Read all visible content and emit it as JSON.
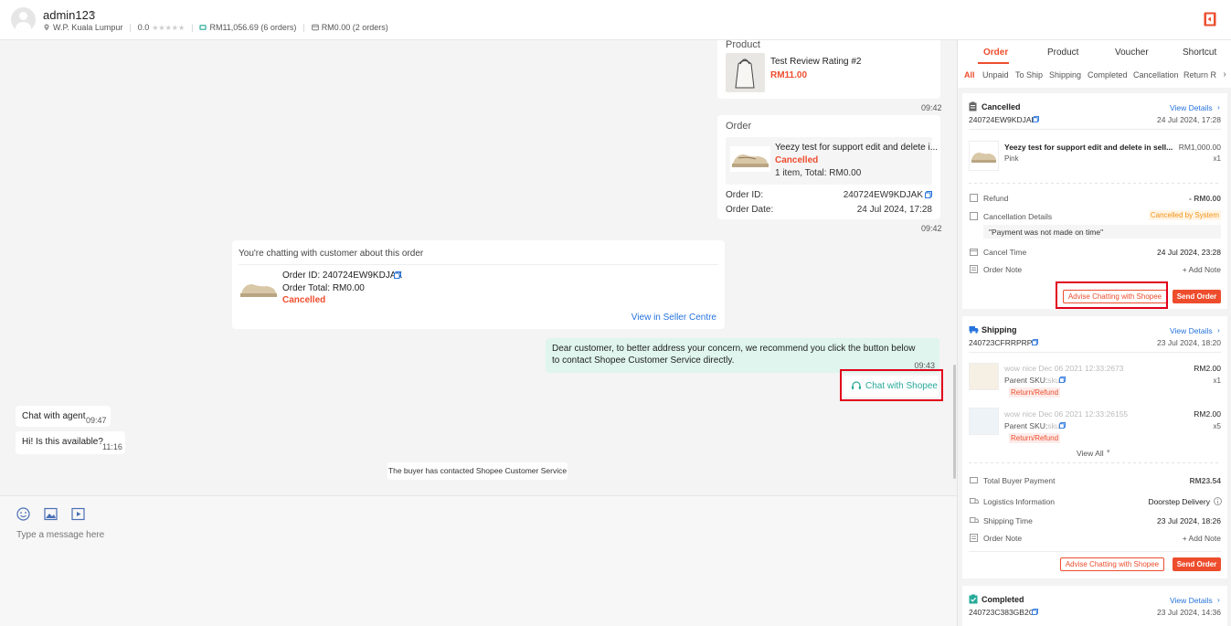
{
  "header": {
    "username": "admin123",
    "location": "W.P. Kuala Lumpur",
    "rating": "0.0",
    "total_orders_value": "RM11,056.69 (6 orders)",
    "pending_value": "RM0.00 (2 orders)",
    "exit_icon": "exit-icon",
    "brand_color": "#ee4d2d"
  },
  "chat": {
    "product_card": {
      "label": "Product",
      "name": "Test Review Rating #2",
      "price": "RM11.00",
      "time": "09:42"
    },
    "order_card": {
      "label": "Order",
      "product": "Yeezy test for support edit and delete i...",
      "status": "Cancelled",
      "summary": "1 item, Total: RM0.00",
      "order_id_label": "Order ID:",
      "order_id": "240724EW9KDJAK",
      "order_date_label": "Order Date:",
      "order_date": "24 Jul 2024, 17:28",
      "time": "09:42"
    },
    "context_card": {
      "title": "You're chatting with customer about this order",
      "order_id": "Order ID: 240724EW9KDJAK",
      "order_total": "Order Total: RM0.00",
      "status": "Cancelled",
      "link": "View in Seller Centre"
    },
    "system_message": {
      "text": "Dear customer, to better address your concern, we recommend you click the button below to contact Shopee Customer Service directly.",
      "time": "09:43",
      "button": "Chat with Shopee"
    },
    "buyer_messages": [
      {
        "text": "Chat with agent",
        "time": "09:47"
      },
      {
        "text": "Hi! Is this available?",
        "time": "11:16"
      }
    ],
    "notice": "The buyer has contacted Shopee Customer Service"
  },
  "composer": {
    "placeholder": "Type a message here",
    "tools": [
      "emoji-icon",
      "image-icon",
      "video-icon"
    ]
  },
  "panel": {
    "tabs": [
      "Order",
      "Product",
      "Voucher",
      "Shortcut"
    ],
    "sub_tabs": [
      "All",
      "Unpaid",
      "To Ship",
      "Shipping",
      "Completed",
      "Cancellation",
      "Return R"
    ],
    "orders": [
      {
        "status": "Cancelled",
        "order_id": "240724EW9KDJAK",
        "view_details": "View Details",
        "date": "24 Jul 2024, 17:28",
        "item_name": "Yeezy test for support edit and delete in sell...",
        "item_price": "RM1,000.00",
        "item_variant": "Pink",
        "item_qty": "x1",
        "refund_label": "Refund",
        "refund_value": "- RM0.00",
        "cancel_details_label": "Cancellation Details",
        "cancel_tag": "Cancelled by System",
        "cancel_reason": "\"Payment was not made on time\"",
        "cancel_time_label": "Cancel Time",
        "cancel_time": "24 Jul 2024, 23:28",
        "note_label": "Order Note",
        "add_note": "+ Add Note",
        "advise_button": "Advise Chatting with Shopee",
        "send_button": "Send Order"
      },
      {
        "status": "Shipping",
        "order_id": "240723CFRRPRPX",
        "view_details": "View Details",
        "date": "23 Jul 2024, 18:20",
        "items": [
          {
            "name": "wow nice Dec 06 2021 12:33:2673",
            "sku_label": "Parent SKU:",
            "sku": "sku",
            "price": "RM2.00",
            "qty": "x1",
            "tag": "Return/Refund"
          },
          {
            "name": "wow nice Dec 06 2021 12:33:26155",
            "sku_label": "Parent SKU:",
            "sku": "sku",
            "price": "RM2.00",
            "qty": "x5",
            "tag": "Return/Refund"
          }
        ],
        "view_all": "View All",
        "payment_label": "Total Buyer Payment",
        "payment_value": "RM23.54",
        "logistics_label": "Logistics Information",
        "logistics_value": "Doorstep Delivery",
        "shipping_time_label": "Shipping Time",
        "shipping_time": "23 Jul 2024, 18:26",
        "note_label": "Order Note",
        "add_note": "+ Add Note",
        "advise_button": "Advise Chatting with Shopee",
        "send_button": "Send Order"
      },
      {
        "status": "Completed",
        "order_id": "240723C383GB2C",
        "view_details": "View Details",
        "date": "23 Jul 2024, 14:36"
      }
    ]
  }
}
